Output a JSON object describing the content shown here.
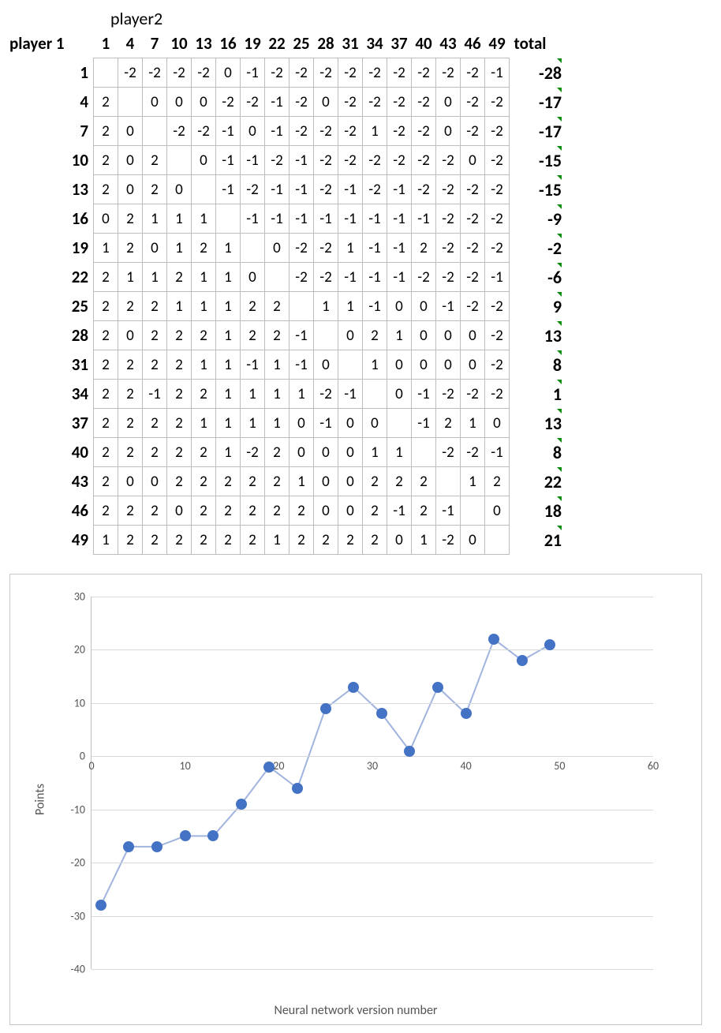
{
  "labels": {
    "player1": "player 1",
    "player2": "player2",
    "total": "total"
  },
  "col_headers": [
    1,
    4,
    7,
    10,
    13,
    16,
    19,
    22,
    25,
    28,
    31,
    34,
    37,
    40,
    43,
    46,
    49
  ],
  "row_headers": [
    1,
    4,
    7,
    10,
    13,
    16,
    19,
    22,
    25,
    28,
    31,
    34,
    37,
    40,
    43,
    46,
    49
  ],
  "cells": [
    [
      null,
      -2,
      -2,
      -2,
      -2,
      0,
      -1,
      -2,
      -2,
      -2,
      -2,
      -2,
      -2,
      -2,
      -2,
      -2,
      -1
    ],
    [
      2,
      null,
      0,
      0,
      0,
      -2,
      -2,
      -1,
      -2,
      0,
      -2,
      -2,
      -2,
      -2,
      0,
      -2,
      -2
    ],
    [
      2,
      0,
      null,
      -2,
      -2,
      -1,
      0,
      -1,
      -2,
      -2,
      -2,
      1,
      -2,
      -2,
      0,
      -2,
      -2
    ],
    [
      2,
      0,
      2,
      null,
      0,
      -1,
      -1,
      -2,
      -1,
      -2,
      -2,
      -2,
      -2,
      -2,
      -2,
      0,
      -2
    ],
    [
      2,
      0,
      2,
      0,
      null,
      -1,
      -2,
      -1,
      -1,
      -2,
      -1,
      -2,
      -1,
      -2,
      -2,
      -2,
      -2
    ],
    [
      0,
      2,
      1,
      1,
      1,
      null,
      -1,
      -1,
      -1,
      -1,
      -1,
      -1,
      -1,
      -1,
      -2,
      -2,
      -2
    ],
    [
      1,
      2,
      0,
      1,
      2,
      1,
      null,
      0,
      -2,
      -2,
      1,
      -1,
      -1,
      2,
      -2,
      -2,
      -2
    ],
    [
      2,
      1,
      1,
      2,
      1,
      1,
      0,
      null,
      -2,
      -2,
      -1,
      -1,
      -1,
      -2,
      -2,
      -2,
      -1
    ],
    [
      2,
      2,
      2,
      1,
      1,
      1,
      2,
      2,
      null,
      1,
      1,
      -1,
      0,
      0,
      -1,
      -2,
      -2
    ],
    [
      2,
      0,
      2,
      2,
      2,
      1,
      2,
      2,
      -1,
      null,
      0,
      2,
      1,
      0,
      0,
      0,
      -2
    ],
    [
      2,
      2,
      2,
      2,
      1,
      1,
      -1,
      1,
      -1,
      0,
      null,
      1,
      0,
      0,
      0,
      0,
      -2
    ],
    [
      2,
      2,
      -1,
      2,
      2,
      1,
      1,
      1,
      1,
      -2,
      -1,
      null,
      0,
      -1,
      -2,
      -2,
      -2
    ],
    [
      2,
      2,
      2,
      2,
      1,
      1,
      1,
      1,
      0,
      -1,
      0,
      0,
      null,
      -1,
      2,
      1,
      0
    ],
    [
      2,
      2,
      2,
      2,
      2,
      1,
      -2,
      2,
      0,
      0,
      0,
      1,
      1,
      null,
      -2,
      -2,
      -1
    ],
    [
      2,
      0,
      0,
      2,
      2,
      2,
      2,
      2,
      1,
      0,
      0,
      2,
      2,
      2,
      null,
      1,
      2
    ],
    [
      2,
      2,
      2,
      0,
      2,
      2,
      2,
      2,
      2,
      0,
      0,
      2,
      -1,
      2,
      -1,
      null,
      0
    ],
    [
      1,
      2,
      2,
      2,
      2,
      2,
      2,
      1,
      2,
      2,
      2,
      2,
      0,
      1,
      -2,
      0,
      null
    ]
  ],
  "totals": [
    -28,
    -17,
    -17,
    -15,
    -15,
    -9,
    -2,
    -6,
    9,
    13,
    8,
    1,
    13,
    8,
    22,
    18,
    21
  ],
  "chart_data": {
    "type": "line",
    "title": "",
    "xlabel": "Neural network version number",
    "ylabel": "Points",
    "xlim": [
      0,
      60
    ],
    "ylim": [
      -40,
      30
    ],
    "yticks": [
      -40,
      -30,
      -20,
      -10,
      0,
      10,
      20,
      30
    ],
    "xticks": [
      0,
      10,
      20,
      30,
      40,
      50,
      60
    ],
    "x": [
      1,
      4,
      7,
      10,
      13,
      16,
      19,
      22,
      25,
      28,
      31,
      34,
      37,
      40,
      43,
      46,
      49
    ],
    "values": [
      -28,
      -17,
      -17,
      -15,
      -15,
      -9,
      -2,
      -6,
      9,
      13,
      8,
      1,
      13,
      8,
      22,
      18,
      21
    ],
    "marker_color": "#4472c4",
    "line_color": "#a0b4de"
  }
}
